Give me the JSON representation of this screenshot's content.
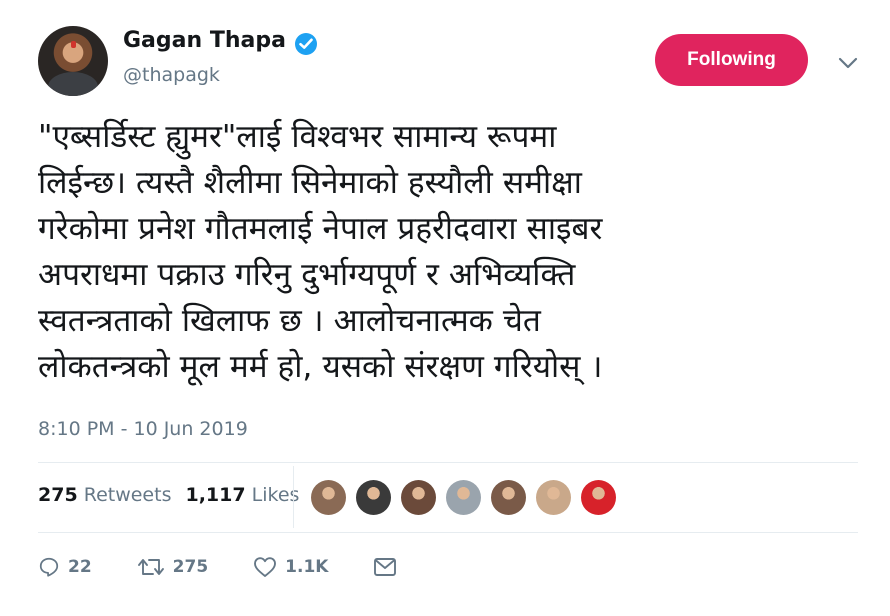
{
  "author": {
    "name": "Gagan Thapa",
    "handle": "@thapagk",
    "verified_icon": "verified-badge-icon"
  },
  "follow_button": {
    "label": "Following",
    "color": "#e0245e"
  },
  "menu": {
    "icon": "chevron-down-icon"
  },
  "tweet": {
    "lines": [
      "\"एब्सर्डिस्ट ह्युमर\"लाई विश्वभर सामान्य रूपमा",
      "लिईन्छ। त्यस्तै शैलीमा सिनेमाको हस्यौली समीक्षा",
      "गरेकोमा प्रनेश गौतमलाई नेपाल प्रहरीदवारा साइबर",
      "अपराधमा पक्राउ गरिनु दुर्भाग्यपूर्ण र अभिव्यक्ति",
      "स्वतन्त्रताको खिलाफ छ । आलोचनात्मक चेत",
      "लोकतन्त्रको मूल मर्म हो, यसको संरक्षण गरियोस् ।"
    ],
    "timestamp": "8:10 PM - 10 Jun 2019"
  },
  "stats": {
    "retweets_count": "275",
    "retweets_label": "Retweets",
    "likes_count": "1,117",
    "likes_label": "Likes"
  },
  "likers": [
    {
      "name": "liker-avatar-1",
      "color": "#8a6a55"
    },
    {
      "name": "liker-avatar-2",
      "color": "#3a3a3a"
    },
    {
      "name": "liker-avatar-3",
      "color": "#6b4a3a"
    },
    {
      "name": "liker-avatar-4",
      "color": "#9aa4ad"
    },
    {
      "name": "liker-avatar-5",
      "color": "#7a5a48"
    },
    {
      "name": "liker-avatar-6",
      "color": "#c9a88a"
    },
    {
      "name": "liker-avatar-7",
      "color": "#d7222a"
    }
  ],
  "actions": {
    "reply_count": "22",
    "retweet_count": "275",
    "like_count": "1.1K"
  },
  "colors": {
    "accent": "#1da1f2",
    "text": "#14171a",
    "muted": "#657786"
  }
}
